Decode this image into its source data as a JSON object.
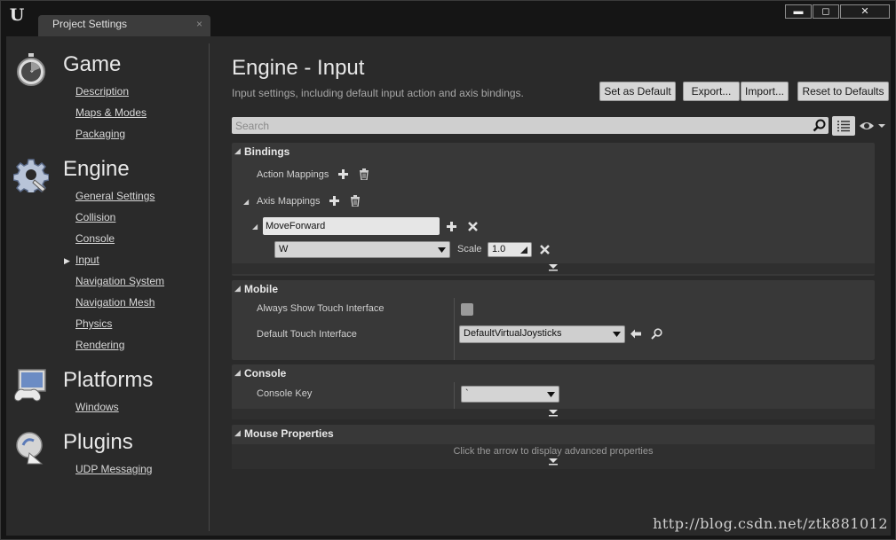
{
  "window": {
    "tab_title": "Project Settings",
    "tab_close": "×",
    "minimize": "▬",
    "maximize": "◻",
    "close": "✕"
  },
  "sidebar": {
    "categories": [
      {
        "title": "Game",
        "icon": "stopwatch-icon",
        "items": [
          "Description",
          "Maps & Modes",
          "Packaging"
        ]
      },
      {
        "title": "Engine",
        "icon": "gear-icon",
        "items": [
          "General Settings",
          "Collision",
          "Console",
          "Input",
          "Navigation System",
          "Navigation Mesh",
          "Physics",
          "Rendering"
        ]
      },
      {
        "title": "Platforms",
        "icon": "monitor-gamepad-icon",
        "items": [
          "Windows"
        ]
      },
      {
        "title": "Plugins",
        "icon": "plug-icon",
        "items": [
          "UDP Messaging"
        ]
      }
    ],
    "selected": "Input"
  },
  "header": {
    "title": "Engine - Input",
    "description": "Input settings, including default input action and axis bindings.",
    "buttons": {
      "set_default": "Set as Default",
      "export": "Export...",
      "import": "Import...",
      "reset": "Reset to Defaults"
    }
  },
  "search": {
    "placeholder": "Search"
  },
  "sections": {
    "bindings": {
      "title": "Bindings",
      "action_mappings": "Action Mappings",
      "axis_mappings": "Axis Mappings",
      "axis_name": "MoveForward",
      "key": "W",
      "scale_label": "Scale",
      "scale_value": "1.0"
    },
    "mobile": {
      "title": "Mobile",
      "always_show_touch": "Always Show Touch Interface",
      "always_show_touch_checked": false,
      "default_touch": "Default Touch Interface",
      "default_touch_value": "DefaultVirtualJoysticks"
    },
    "console": {
      "title": "Console",
      "console_key": "Console Key",
      "console_key_value": "`"
    },
    "mouse": {
      "title": "Mouse Properties",
      "advanced_hint": "Click the arrow to display advanced properties"
    }
  },
  "watermark": "http://blog.csdn.net/ztk881012",
  "colors": {
    "panel": "#383838",
    "background": "#2a2a2a",
    "button": "#d6d6d6"
  }
}
